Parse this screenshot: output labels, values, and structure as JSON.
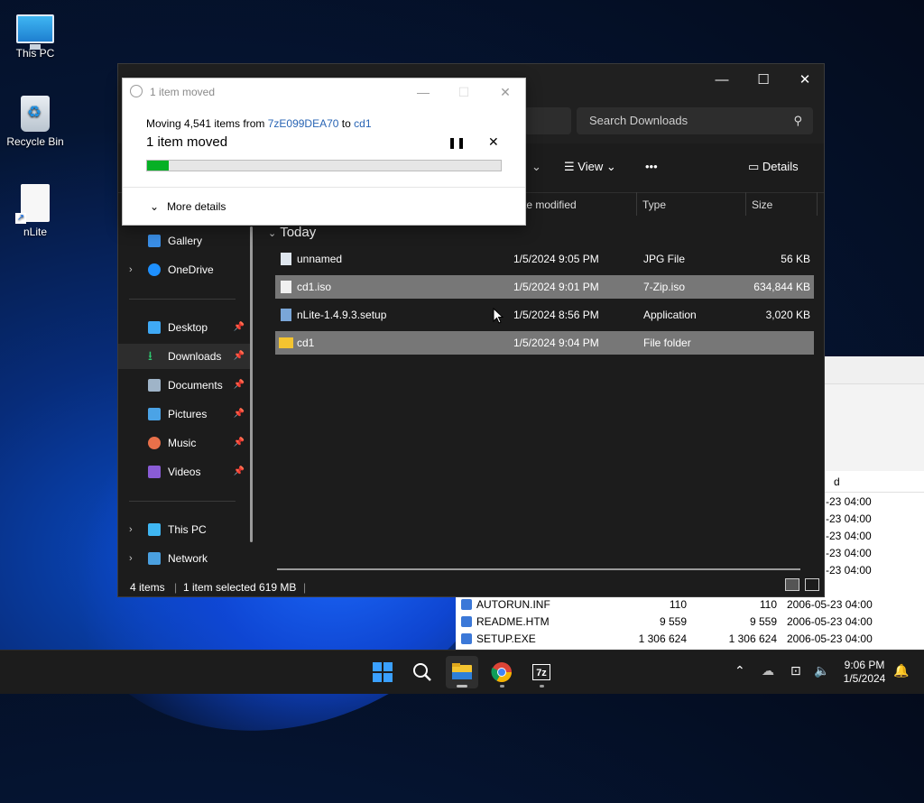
{
  "desktop": {
    "icons": [
      {
        "label": "This PC"
      },
      {
        "label": "Recycle Bin"
      },
      {
        "label": "nLite"
      }
    ]
  },
  "zip_window": {
    "column_header": "d",
    "dates_only": [
      "-23 04:00",
      "-23 04:00",
      "-23 04:00",
      "-23 04:00",
      "-23 04:00"
    ],
    "dates_prefix": "2006-05",
    "rows": [
      {
        "name": "AUTORUN.INF",
        "size": "110",
        "packed": "110",
        "modified": "2006-05-23 04:00"
      },
      {
        "name": "README.HTM",
        "size": "9 559",
        "packed": "9 559",
        "modified": "2006-05-23 04:00"
      },
      {
        "name": "SETUP.EXE",
        "size": "1 306 624",
        "packed": "1 306 624",
        "modified": "2006-05-23 04:00"
      }
    ]
  },
  "explorer": {
    "search_placeholder": "Search Downloads",
    "toolbar": {
      "view": "View",
      "more": "•••",
      "details": "Details"
    },
    "columns": {
      "date": "te modified",
      "type": "Type",
      "size": "Size"
    },
    "nav": {
      "gallery": "Gallery",
      "onedrive": "OneDrive",
      "desktop": "Desktop",
      "downloads": "Downloads",
      "documents": "Documents",
      "pictures": "Pictures",
      "music": "Music",
      "videos": "Videos",
      "thispc": "This PC",
      "network": "Network"
    },
    "group": "Today",
    "files": [
      {
        "name": "unnamed",
        "date": "1/5/2024 9:05 PM",
        "type": "JPG File",
        "size": "56 KB"
      },
      {
        "name": "cd1.iso",
        "date": "1/5/2024 9:01 PM",
        "type": "7-Zip.iso",
        "size": "634,844 KB"
      },
      {
        "name": "nLite-1.4.9.3.setup",
        "date": "1/5/2024 8:56 PM",
        "type": "Application",
        "size": "3,020 KB"
      },
      {
        "name": "cd1",
        "date": "1/5/2024 9:04 PM",
        "type": "File folder",
        "size": ""
      }
    ],
    "status": {
      "count": "4 items",
      "selected": "1 item selected  619 MB"
    }
  },
  "dialog": {
    "title": "1 item moved",
    "from_prefix": "Moving 4,541 items from ",
    "from_src": "7zE099DEA70",
    "from_mid": " to ",
    "from_dst": "cd1",
    "status": "1 item moved",
    "progress": 0.06,
    "more_details": "More details"
  },
  "taskbar": {
    "time": "9:06 PM",
    "date": "1/5/2024"
  },
  "colors": {
    "progress": "#06b025",
    "link": "#2864b4",
    "selection": "#777777"
  }
}
